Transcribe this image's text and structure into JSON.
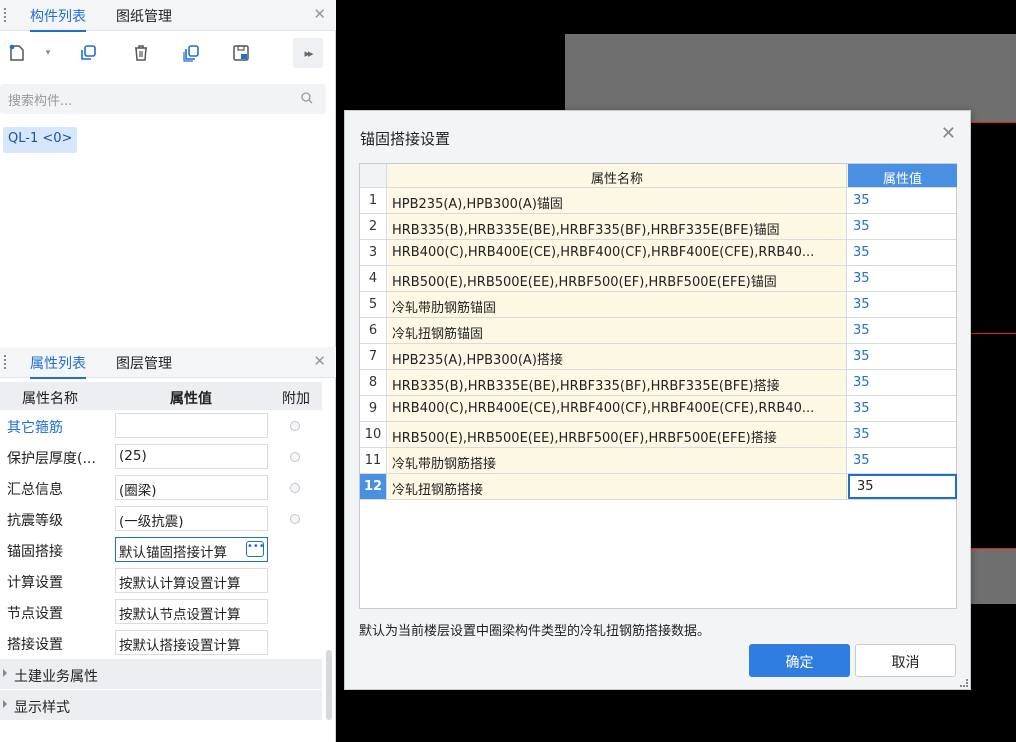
{
  "left_panel": {
    "top_tabs": [
      {
        "label": "构件列表"
      },
      {
        "label": "图纸管理"
      }
    ],
    "search_placeholder": "搜索构件...",
    "component": "QL-1 <0>",
    "prop_tabs": [
      {
        "label": "属性列表"
      },
      {
        "label": "图层管理"
      }
    ],
    "prop_headers": {
      "name": "属性名称",
      "value": "属性值",
      "extra": "附加"
    },
    "props": [
      {
        "name": "其它箍筋",
        "value": ""
      },
      {
        "name": "保护层厚度(...",
        "value": "(25)"
      },
      {
        "name": "汇总信息",
        "value": "(圈梁)"
      },
      {
        "name": "抗震等级",
        "value": "(一级抗震)"
      },
      {
        "name": "锚固搭接",
        "value": "默认锚固搭接计算"
      },
      {
        "name": "计算设置",
        "value": "按默认计算设置计算"
      },
      {
        "name": "节点设置",
        "value": "按默认节点设置计算"
      },
      {
        "name": "搭接设置",
        "value": "按默认搭接设置计算"
      }
    ],
    "groups": [
      {
        "label": "土建业务属性"
      },
      {
        "label": "显示样式"
      }
    ]
  },
  "dialog": {
    "title": "锚固搭接设置",
    "col_name": "属性名称",
    "col_value": "属性值",
    "rows": [
      {
        "idx": "1",
        "name": "HPB235(A),HPB300(A)锚固",
        "value": "35"
      },
      {
        "idx": "2",
        "name": "HRB335(B),HRB335E(BE),HRBF335(BF),HRBF335E(BFE)锚固",
        "value": "35"
      },
      {
        "idx": "3",
        "name": "HRB400(C),HRB400E(CE),HRBF400(CF),HRBF400E(CFE),RRB40...",
        "value": "35"
      },
      {
        "idx": "4",
        "name": "HRB500(E),HRB500E(EE),HRBF500(EF),HRBF500E(EFE)锚固",
        "value": "35"
      },
      {
        "idx": "5",
        "name": "冷轧带肋钢筋锚固",
        "value": "35"
      },
      {
        "idx": "6",
        "name": "冷轧扭钢筋锚固",
        "value": "35"
      },
      {
        "idx": "7",
        "name": "HPB235(A),HPB300(A)搭接",
        "value": "35"
      },
      {
        "idx": "8",
        "name": "HRB335(B),HRB335E(BE),HRBF335(BF),HRBF335E(BFE)搭接",
        "value": "35"
      },
      {
        "idx": "9",
        "name": "HRB400(C),HRB400E(CE),HRBF400(CF),HRBF400E(CFE),RRB40...",
        "value": "35"
      },
      {
        "idx": "10",
        "name": "HRB500(E),HRB500E(EE),HRBF500(EF),HRBF500E(EFE)搭接",
        "value": "35"
      },
      {
        "idx": "11",
        "name": "冷轧带肋钢筋搭接",
        "value": "35"
      },
      {
        "idx": "12",
        "name": "冷轧扭钢筋搭接",
        "value": "35"
      }
    ],
    "hint": "默认为当前楼层设置中圈梁构件类型的冷轧扭钢筋搭接数据。",
    "ok_label": "确定",
    "cancel_label": "取消"
  },
  "colors": {
    "accent": "#1f6fd1",
    "header_blue": "#4a90e2",
    "name_cell": "#fdf8e4",
    "red_line": "#e02020"
  }
}
